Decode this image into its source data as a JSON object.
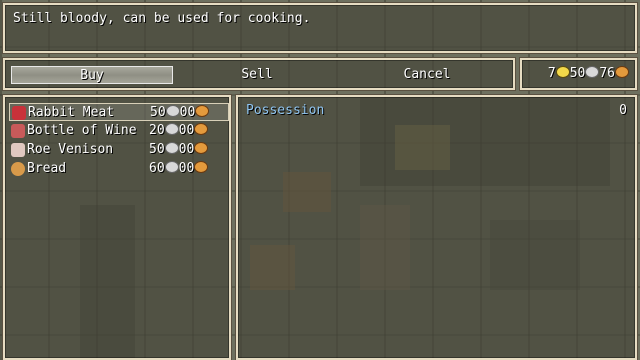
{
  "help": {
    "text": "Still bloody, can be used for cooking."
  },
  "commands": [
    {
      "label": "Buy",
      "selected": true
    },
    {
      "label": "Sell",
      "selected": false
    },
    {
      "label": "Cancel",
      "selected": false
    }
  ],
  "gold": {
    "gold_value": "7",
    "silver_value": "50",
    "copper_value": "76"
  },
  "items": [
    {
      "name": "Rabbit Meat",
      "price": "50",
      "price_rest": "00",
      "icon": "meat-icon",
      "icon_color": "#c8323a",
      "selected": true
    },
    {
      "name": "Bottle of Wine",
      "price": "20",
      "price_rest": "00",
      "icon": "wine-bottle-icon",
      "icon_color": "#c85a5a",
      "selected": false
    },
    {
      "name": "Roe Venison",
      "price": "50",
      "price_rest": "00",
      "icon": "venison-icon",
      "icon_color": "#e0c8c0",
      "selected": false
    },
    {
      "name": "Bread",
      "price": "60",
      "price_rest": "00",
      "icon": "bread-icon",
      "icon_color": "#d89a4a",
      "selected": false
    }
  ],
  "status": {
    "possession_label": "Possession",
    "possession_value": "0"
  },
  "colors": {
    "gold": "#f3d94a",
    "silver": "#d8d8d8",
    "copper": "#e49a3c",
    "label_blue": "#8fc4f0"
  }
}
